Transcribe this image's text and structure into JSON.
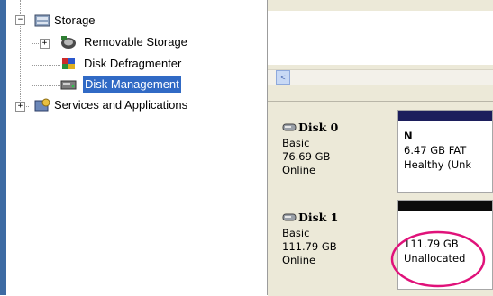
{
  "tree": {
    "items": [
      {
        "label": "Storage",
        "icon": "storage-icon",
        "expander": "−"
      },
      {
        "label": "Removable Storage",
        "icon": "removable-storage-icon",
        "expander": "+"
      },
      {
        "label": "Disk Defragmenter",
        "icon": "disk-defragmenter-icon"
      },
      {
        "label": "Disk Management",
        "icon": "disk-management-icon",
        "selected": true
      },
      {
        "label": "Services and Applications",
        "icon": "services-icon",
        "expander": "+"
      }
    ]
  },
  "scroll": {
    "left_arrow": "<"
  },
  "disks": [
    {
      "name": "Disk 0",
      "type": "Basic",
      "size": "76.69 GB",
      "status": "Online",
      "partition": {
        "letter": "N",
        "size_fs": "6.47 GB FAT",
        "health": "Healthy (Unk",
        "bar_color": "#1c1e5c"
      }
    },
    {
      "name": "Disk 1",
      "type": "Basic",
      "size": "111.79 GB",
      "status": "Online",
      "partition": {
        "size": "111.79 GB",
        "state": "Unallocated",
        "bar_color": "#0a0a0a"
      }
    }
  ],
  "colors": {
    "selection": "#316ac5",
    "highlight_ellipse": "#e0127a",
    "left_edge": "#3d6ba3"
  }
}
